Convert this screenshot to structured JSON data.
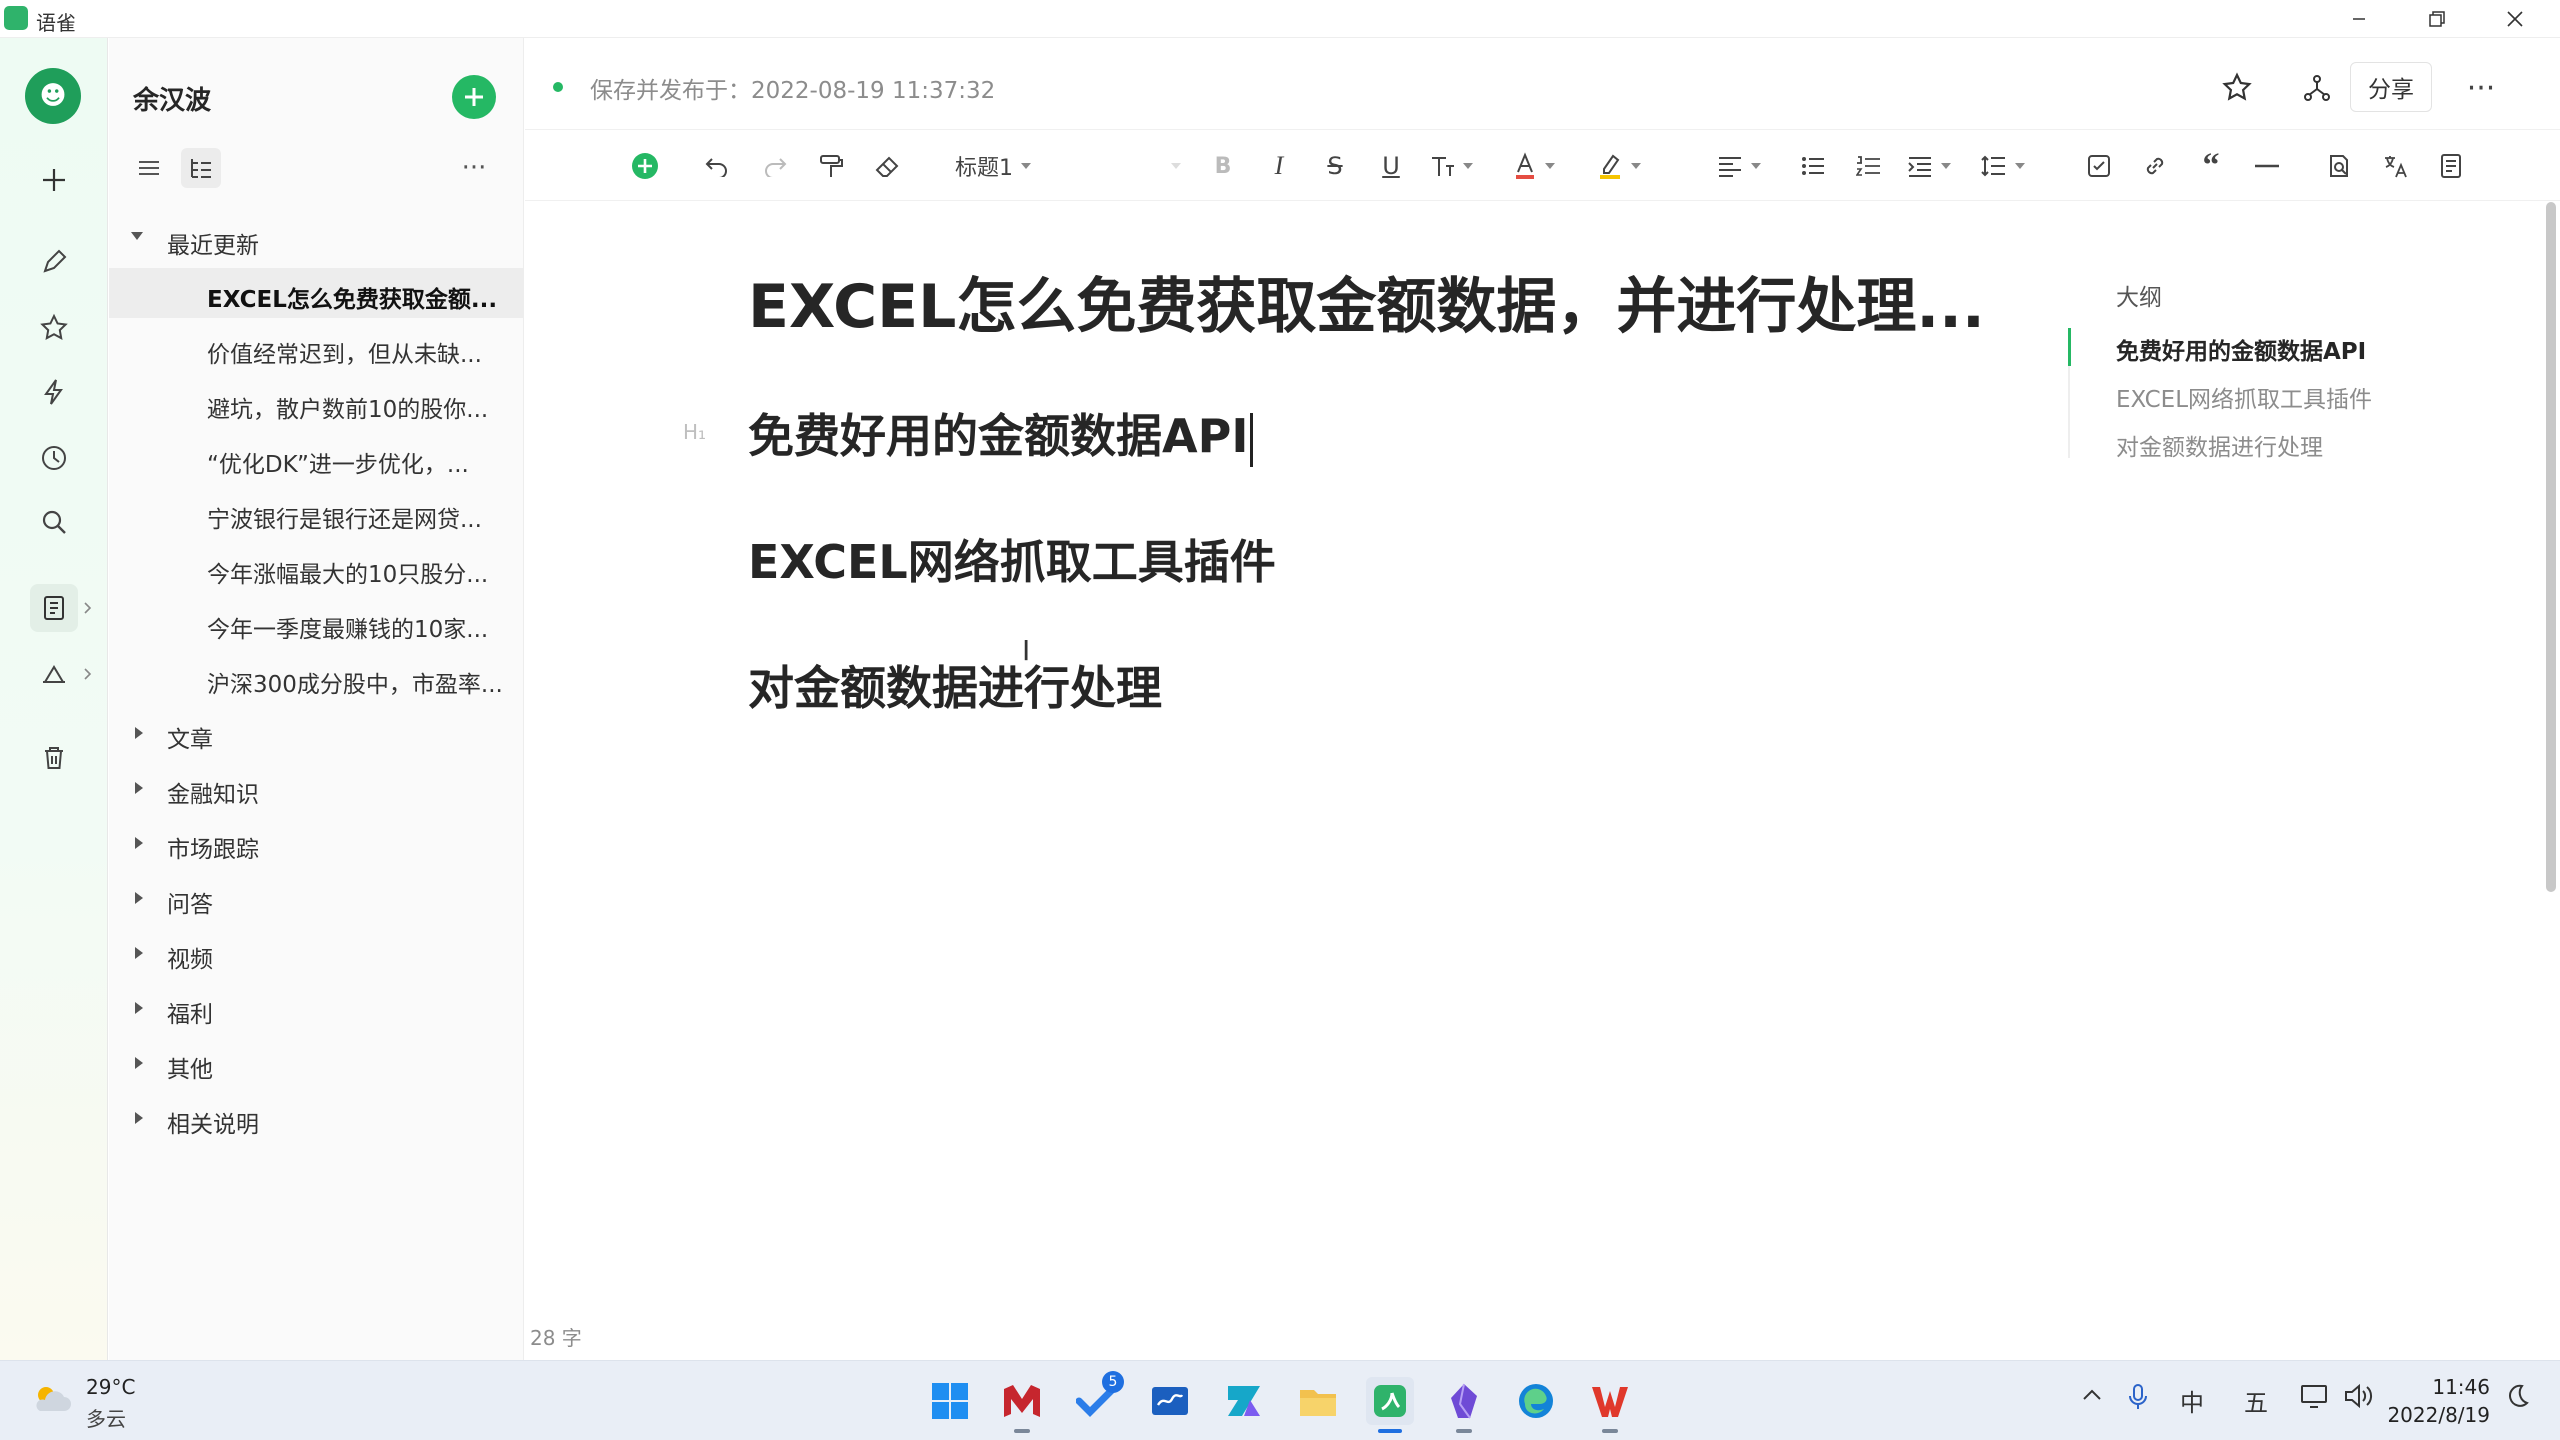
{
  "window": {
    "title": "语雀"
  },
  "sidebar": {
    "user_name": "余汉波"
  },
  "tree": {
    "recent": {
      "label": "最近更新",
      "items": [
        "EXCEL怎么免费获取金额...",
        "价值经常迟到，但从未缺...",
        "避坑，散户数前10的股你...",
        "“优化DK”进一步优化，...",
        "宁波银行是银行还是网贷...",
        "今年涨幅最大的10只股分...",
        "今年一季度最赚钱的10家...",
        "沪深300成分股中，市盈率..."
      ]
    },
    "groups": [
      "文章",
      "金融知识",
      "市场跟踪",
      "问答",
      "视频",
      "福利",
      "其他",
      "相关说明"
    ]
  },
  "header": {
    "save_status": "保存并发布于：2022-08-19 11:37:32",
    "share_label": "分享"
  },
  "toolbar": {
    "heading_select": "标题1"
  },
  "document": {
    "title": "EXCEL怎么免费获取金额数据，并进行处理...",
    "heading_marker": "H₁",
    "headings": [
      "免费好用的金额数据API",
      "EXCEL网络抓取工具插件",
      "对金额数据进行处理"
    ]
  },
  "outline": {
    "title": "大纲",
    "items": [
      "免费好用的金额数据API",
      "EXCEL网络抓取工具插件",
      "对金额数据进行处理"
    ]
  },
  "status": {
    "word_count": "28 字"
  },
  "taskbar": {
    "weather_temp": "29°C",
    "weather_desc": "多云",
    "todo_badge": "5",
    "ime_lang": "中",
    "ime_mode": "五",
    "time": "11:46",
    "date": "2022/8/19"
  },
  "colors": {
    "accent": "#25b864",
    "text": "#262626",
    "muted": "#8c8c8c"
  }
}
